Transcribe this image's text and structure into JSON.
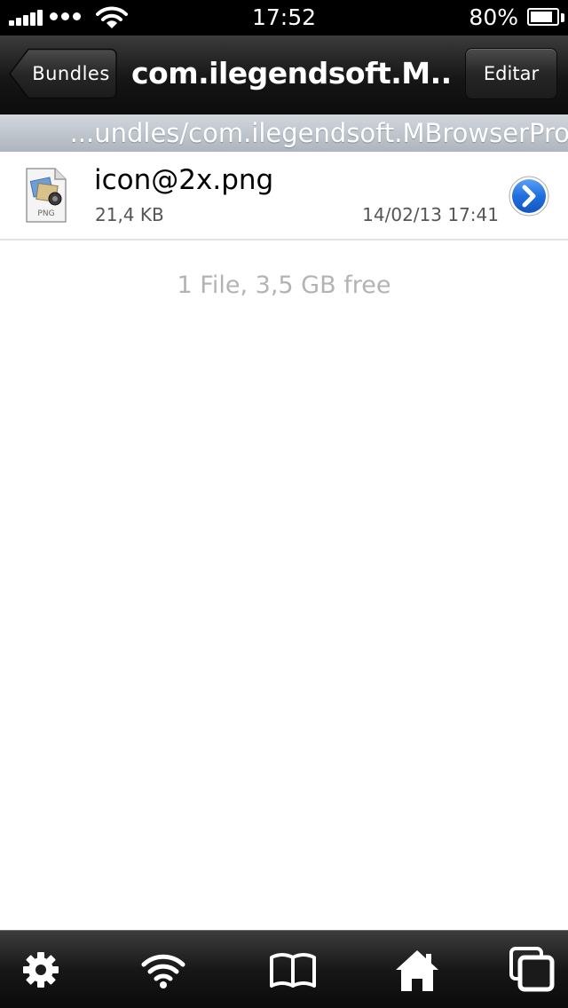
{
  "status_bar": {
    "time": "17:52",
    "battery_percent": "80%",
    "battery_level": 0.8,
    "signal_bars": 5
  },
  "nav": {
    "back_label": "Bundles",
    "title": "com.ilegendsoft.M...",
    "edit_label": "Editar"
  },
  "path": {
    "text": "...undles/com.ilegendsoft.MBrowserPro"
  },
  "files": [
    {
      "name": "icon@2x.png",
      "size": "21,4 KB",
      "date": "14/02/13  17:41",
      "icon": "png-file-icon",
      "badge": "PNG"
    }
  ],
  "summary": "1 File, 3,5 GB free",
  "toolbar": {
    "items": [
      "gear-icon",
      "wifi-icon",
      "book-icon",
      "home-icon",
      "windows-icon"
    ]
  },
  "colors": {
    "disclosure_blue": "#1f6fe0",
    "summary_gray": "#b3b3b3"
  }
}
